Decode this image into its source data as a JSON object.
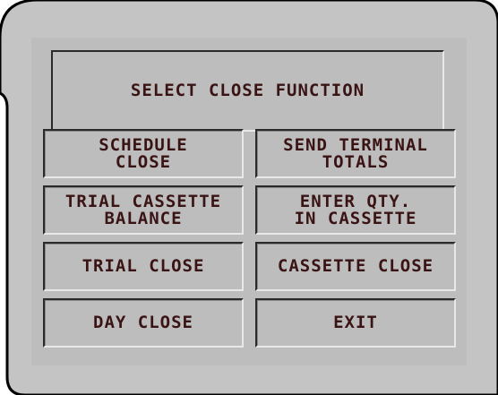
{
  "screen": {
    "title": "SELECT CLOSE FUNCTION"
  },
  "buttons": [
    {
      "label": "SCHEDULE\nCLOSE"
    },
    {
      "label": "SEND TERMINAL\nTOTALS"
    },
    {
      "label": "TRIAL CASSETTE\nBALANCE"
    },
    {
      "label": "ENTER QTY.\nIN CASSETTE"
    },
    {
      "label": "TRIAL CLOSE"
    },
    {
      "label": "CASSETTE CLOSE"
    },
    {
      "label": "DAY CLOSE"
    },
    {
      "label": "EXIT"
    }
  ],
  "colors": {
    "panel": "#bdbdbd",
    "text": "#3a1414",
    "bezel": "#c4c4c4"
  }
}
